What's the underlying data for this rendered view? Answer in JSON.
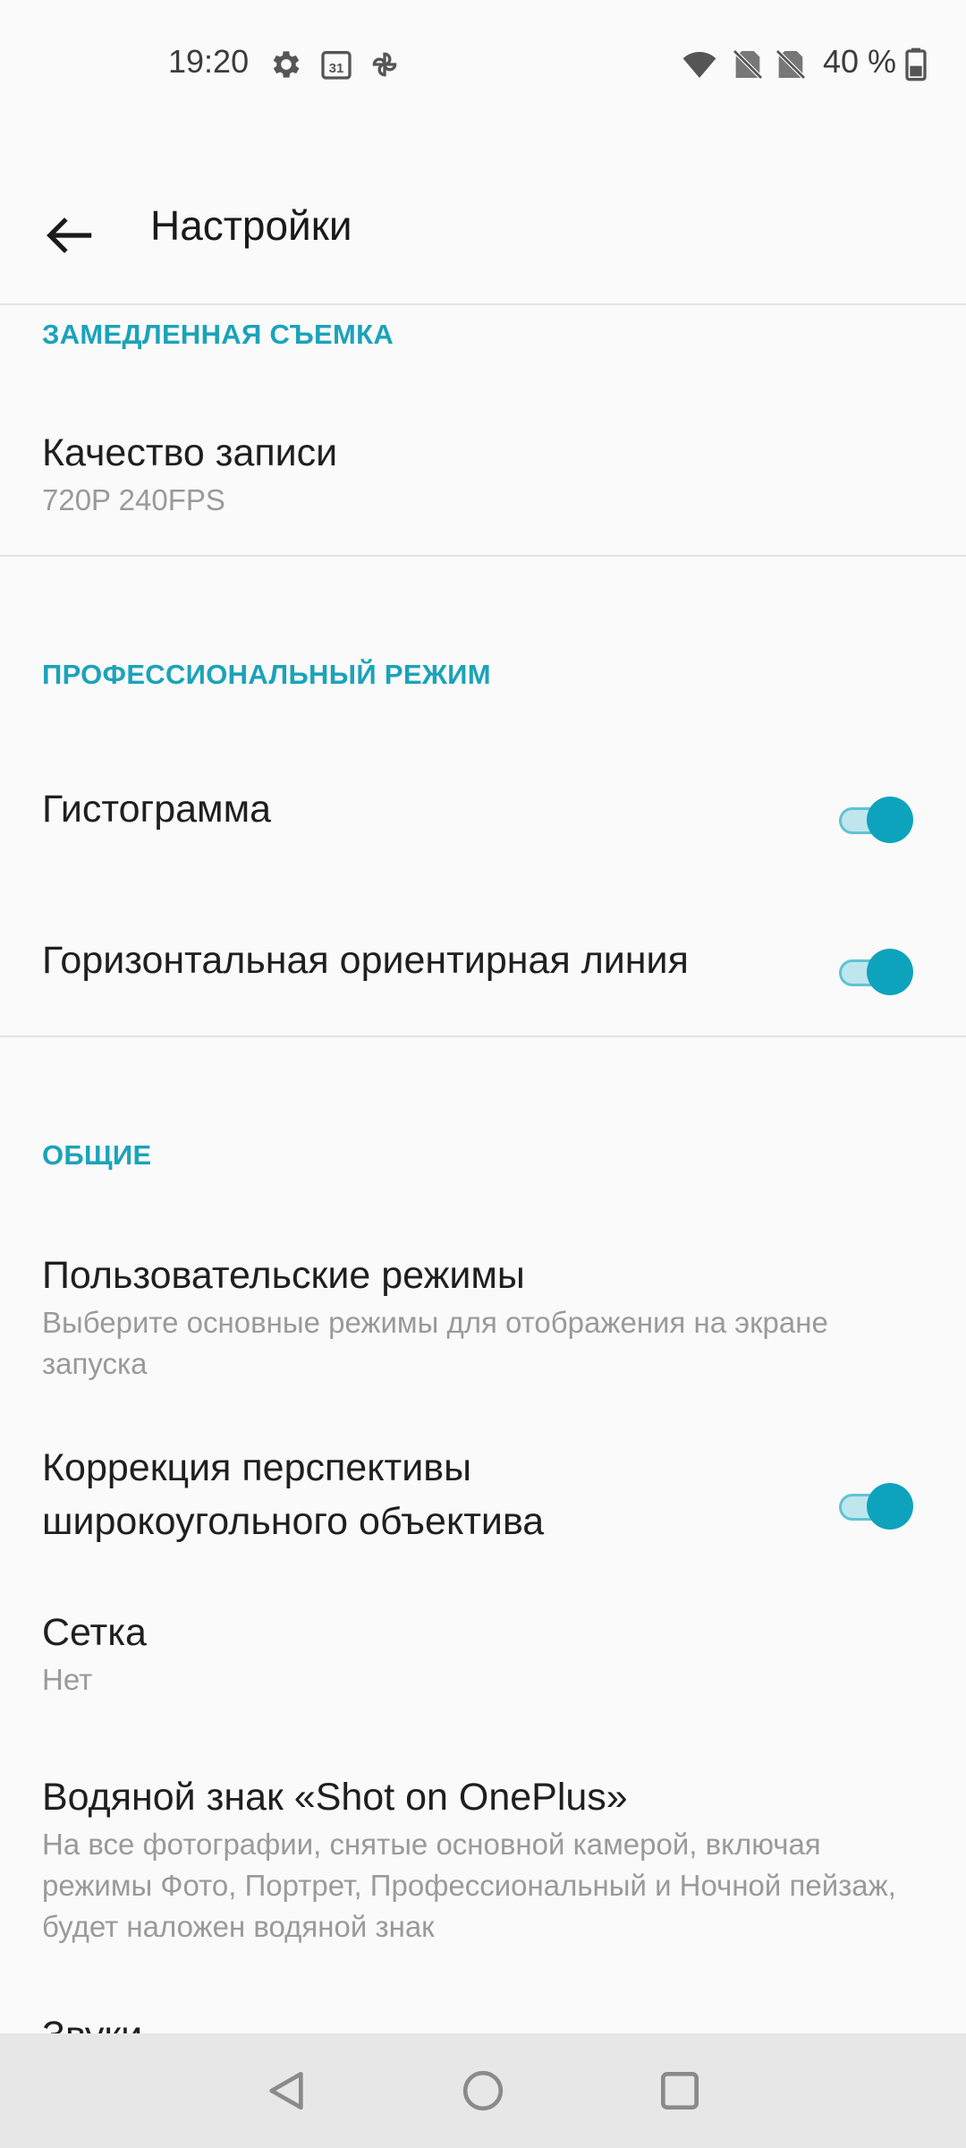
{
  "status_bar": {
    "time": "19:20",
    "battery_text": "40 %",
    "icons": [
      "gear-icon",
      "calendar-icon",
      "pinwheel-icon",
      "wifi-icon",
      "no-sim-icon",
      "no-sim-icon",
      "battery-icon"
    ],
    "calendar_day": "31"
  },
  "app_bar": {
    "title": "Настройки"
  },
  "sections": {
    "slow_motion": {
      "header": "ЗАМЕДЛЕННАЯ СЪЕМКА",
      "quality": {
        "title": "Качество записи",
        "value": "720P 240FPS"
      }
    },
    "pro_mode": {
      "header": "ПРОФЕССИОНАЛЬНЫЙ РЕЖИМ",
      "histogram": {
        "title": "Гистограмма",
        "enabled": true
      },
      "horizon": {
        "title": "Горизонтальная ориентирная линия",
        "enabled": true
      }
    },
    "general": {
      "header": "ОБЩИЕ",
      "custom_modes": {
        "title": "Пользовательские режимы",
        "subtitle": "Выберите основные режимы для отображения на экране запуска"
      },
      "perspective": {
        "title_line1": "Коррекция перспективы",
        "title_line2": "широкоугольного объектива",
        "enabled": true
      },
      "grid": {
        "title": "Сетка",
        "value": "Нет"
      },
      "watermark": {
        "title": "Водяной знак «Shot on OnePlus»",
        "subtitle": "На все фотографии, снятые основной камерой, включая режимы Фото, Портрет, Профессиональный и Ночной пейзаж, будет наложен водяной знак"
      },
      "next_item_partial": "Звуки"
    }
  },
  "colors": {
    "accent": "#1ba3b9",
    "toggle_thumb": "#0ea3bd",
    "background": "#fafafa",
    "nav_bar": "#e7e7e7"
  }
}
